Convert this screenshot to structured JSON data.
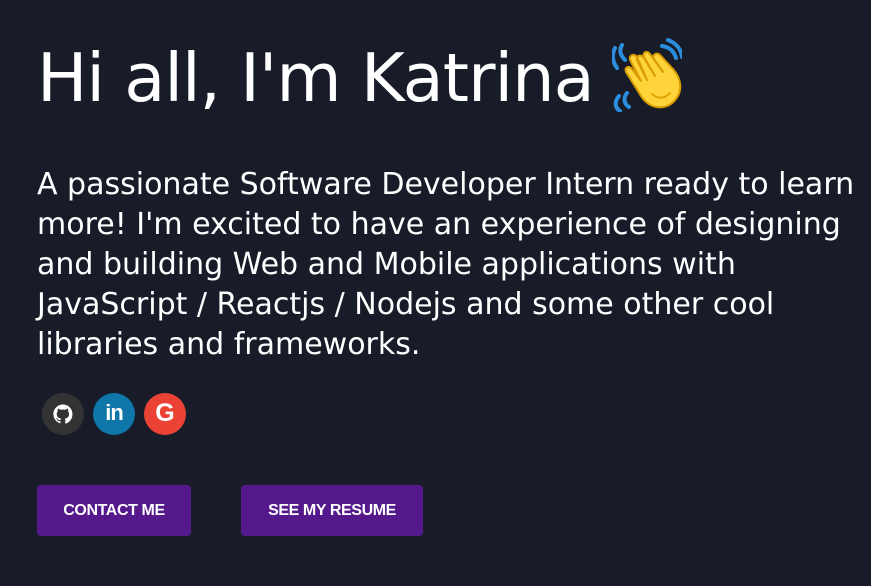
{
  "hero": {
    "greeting": "Hi all, I'm Katrina",
    "wave_icon": "waving-hand-icon",
    "intro": "A passionate Software Developer Intern ready to learn more! I'm excited to have an experience of designing and building Web and Mobile applications with JavaScript / Reactjs / Nodejs and some other cool libraries and frameworks."
  },
  "social": {
    "github": {
      "icon": "github-icon",
      "color": "#333333"
    },
    "linkedin": {
      "icon": "linkedin-icon",
      "label": "in",
      "color": "#0e76a8"
    },
    "google": {
      "icon": "google-icon",
      "label": "G",
      "color": "#ea4335"
    }
  },
  "actions": {
    "contact_label": "CONTACT ME",
    "resume_label": "SEE MY RESUME",
    "button_color": "#55198b"
  },
  "theme": {
    "background": "#171c28",
    "text": "#ffffff"
  }
}
